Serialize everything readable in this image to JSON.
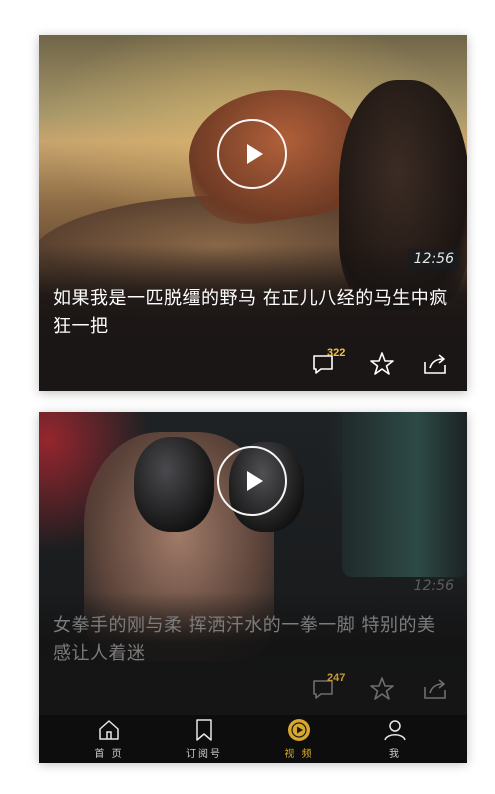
{
  "feed": [
    {
      "duration": "12:56",
      "title": "如果我是一匹脱缰的野马 在正儿八经的马生中疯狂一把",
      "comment_count": "322"
    },
    {
      "duration": "12:56",
      "title": "女拳手的刚与柔 挥洒汗水的一拳一脚 特别的美感让人着迷",
      "comment_count": "247"
    }
  ],
  "tabbar": {
    "home": "首 页",
    "subscriptions": "订阅号",
    "video": "视 频",
    "me": "我"
  },
  "icons": {
    "play": "play-icon",
    "comment": "comment-icon",
    "favorite": "star-icon",
    "share": "share-icon",
    "home": "home-icon",
    "subscriptions": "bookmark-icon",
    "video": "video-play-icon",
    "me": "person-icon"
  },
  "colors": {
    "accent": "#d9a72c",
    "count_badge": "#f3c24a"
  }
}
